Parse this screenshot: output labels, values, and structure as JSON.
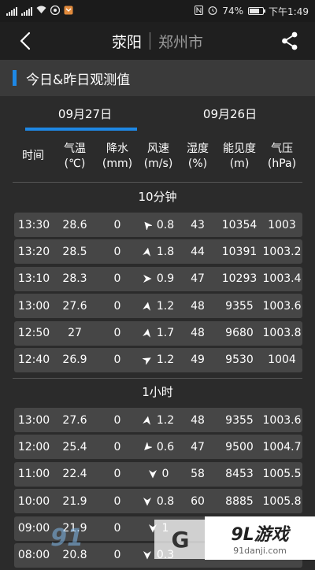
{
  "status_bar": {
    "signal_text": "⁴⁶",
    "battery_text": "74%",
    "time_text": "下午1:49",
    "battery_level": 0.74
  },
  "header": {
    "city": "荥阳",
    "region": "郑州市"
  },
  "section": {
    "title": "今日&昨日观测值"
  },
  "tabs": [
    {
      "label": "09月27日",
      "active": true
    },
    {
      "label": "09月26日",
      "active": false
    }
  ],
  "columns": [
    {
      "line1": "时间",
      "line2": ""
    },
    {
      "line1": "气温",
      "line2": "(℃)"
    },
    {
      "line1": "降水",
      "line2": "(mm)"
    },
    {
      "line1": "风速",
      "line2": "(m/s)"
    },
    {
      "line1": "湿度",
      "line2": "(%)"
    },
    {
      "line1": "能见度",
      "line2": "(m)"
    },
    {
      "line1": "气压",
      "line2": "(hPa)"
    }
  ],
  "group_10min": {
    "title": "10分钟",
    "rows": [
      {
        "time": "13:30",
        "temp": "28.6",
        "rain": "0",
        "wind": "0.8",
        "wind_dir": 320,
        "humidity": "43",
        "visibility": "10354",
        "pressure": "1003"
      },
      {
        "time": "13:20",
        "temp": "28.5",
        "rain": "0",
        "wind": "1.8",
        "wind_dir": 10,
        "humidity": "44",
        "visibility": "10391",
        "pressure": "1003.2"
      },
      {
        "time": "13:10",
        "temp": "28.3",
        "rain": "0",
        "wind": "0.9",
        "wind_dir": 90,
        "humidity": "47",
        "visibility": "10293",
        "pressure": "1003.4"
      },
      {
        "time": "13:00",
        "temp": "27.6",
        "rain": "0",
        "wind": "1.2",
        "wind_dir": 10,
        "humidity": "48",
        "visibility": "9355",
        "pressure": "1003.6"
      },
      {
        "time": "12:50",
        "temp": "27",
        "rain": "0",
        "wind": "1.7",
        "wind_dir": 10,
        "humidity": "48",
        "visibility": "9680",
        "pressure": "1003.8"
      },
      {
        "time": "12:40",
        "temp": "26.9",
        "rain": "0",
        "wind": "1.2",
        "wind_dir": 60,
        "humidity": "49",
        "visibility": "9530",
        "pressure": "1004"
      }
    ]
  },
  "group_1h": {
    "title": "1小时",
    "rows": [
      {
        "time": "13:00",
        "temp": "27.6",
        "rain": "0",
        "wind": "1.2",
        "wind_dir": 10,
        "humidity": "48",
        "visibility": "9355",
        "pressure": "1003.6"
      },
      {
        "time": "12:00",
        "temp": "25.4",
        "rain": "0",
        "wind": "0.6",
        "wind_dir": 225,
        "humidity": "47",
        "visibility": "9500",
        "pressure": "1004.7"
      },
      {
        "time": "11:00",
        "temp": "22.4",
        "rain": "0",
        "wind": "0",
        "wind_dir": 180,
        "humidity": "58",
        "visibility": "8453",
        "pressure": "1005.5"
      },
      {
        "time": "10:00",
        "temp": "21.9",
        "rain": "0",
        "wind": "0.8",
        "wind_dir": 180,
        "humidity": "60",
        "visibility": "8885",
        "pressure": "1005.8"
      },
      {
        "time": "09:00",
        "temp": "21.9",
        "rain": "0",
        "wind": "1",
        "wind_dir": 180,
        "humidity": "",
        "visibility": "",
        "pressure": ""
      },
      {
        "time": "08:00",
        "temp": "20.8",
        "rain": "0",
        "wind": "0.3",
        "wind_dir": 180,
        "humidity": "",
        "visibility": "",
        "pressure": ""
      }
    ]
  },
  "watermark": {
    "left_logo": "91",
    "left_sub": "91danji.com",
    "mid_text": "G",
    "right_logo": "9L游戏",
    "right_url": "91danji.com"
  },
  "colors": {
    "accent": "#1e88e5",
    "row_bg": "#464646",
    "page_bg": "#2b2b2b"
  }
}
